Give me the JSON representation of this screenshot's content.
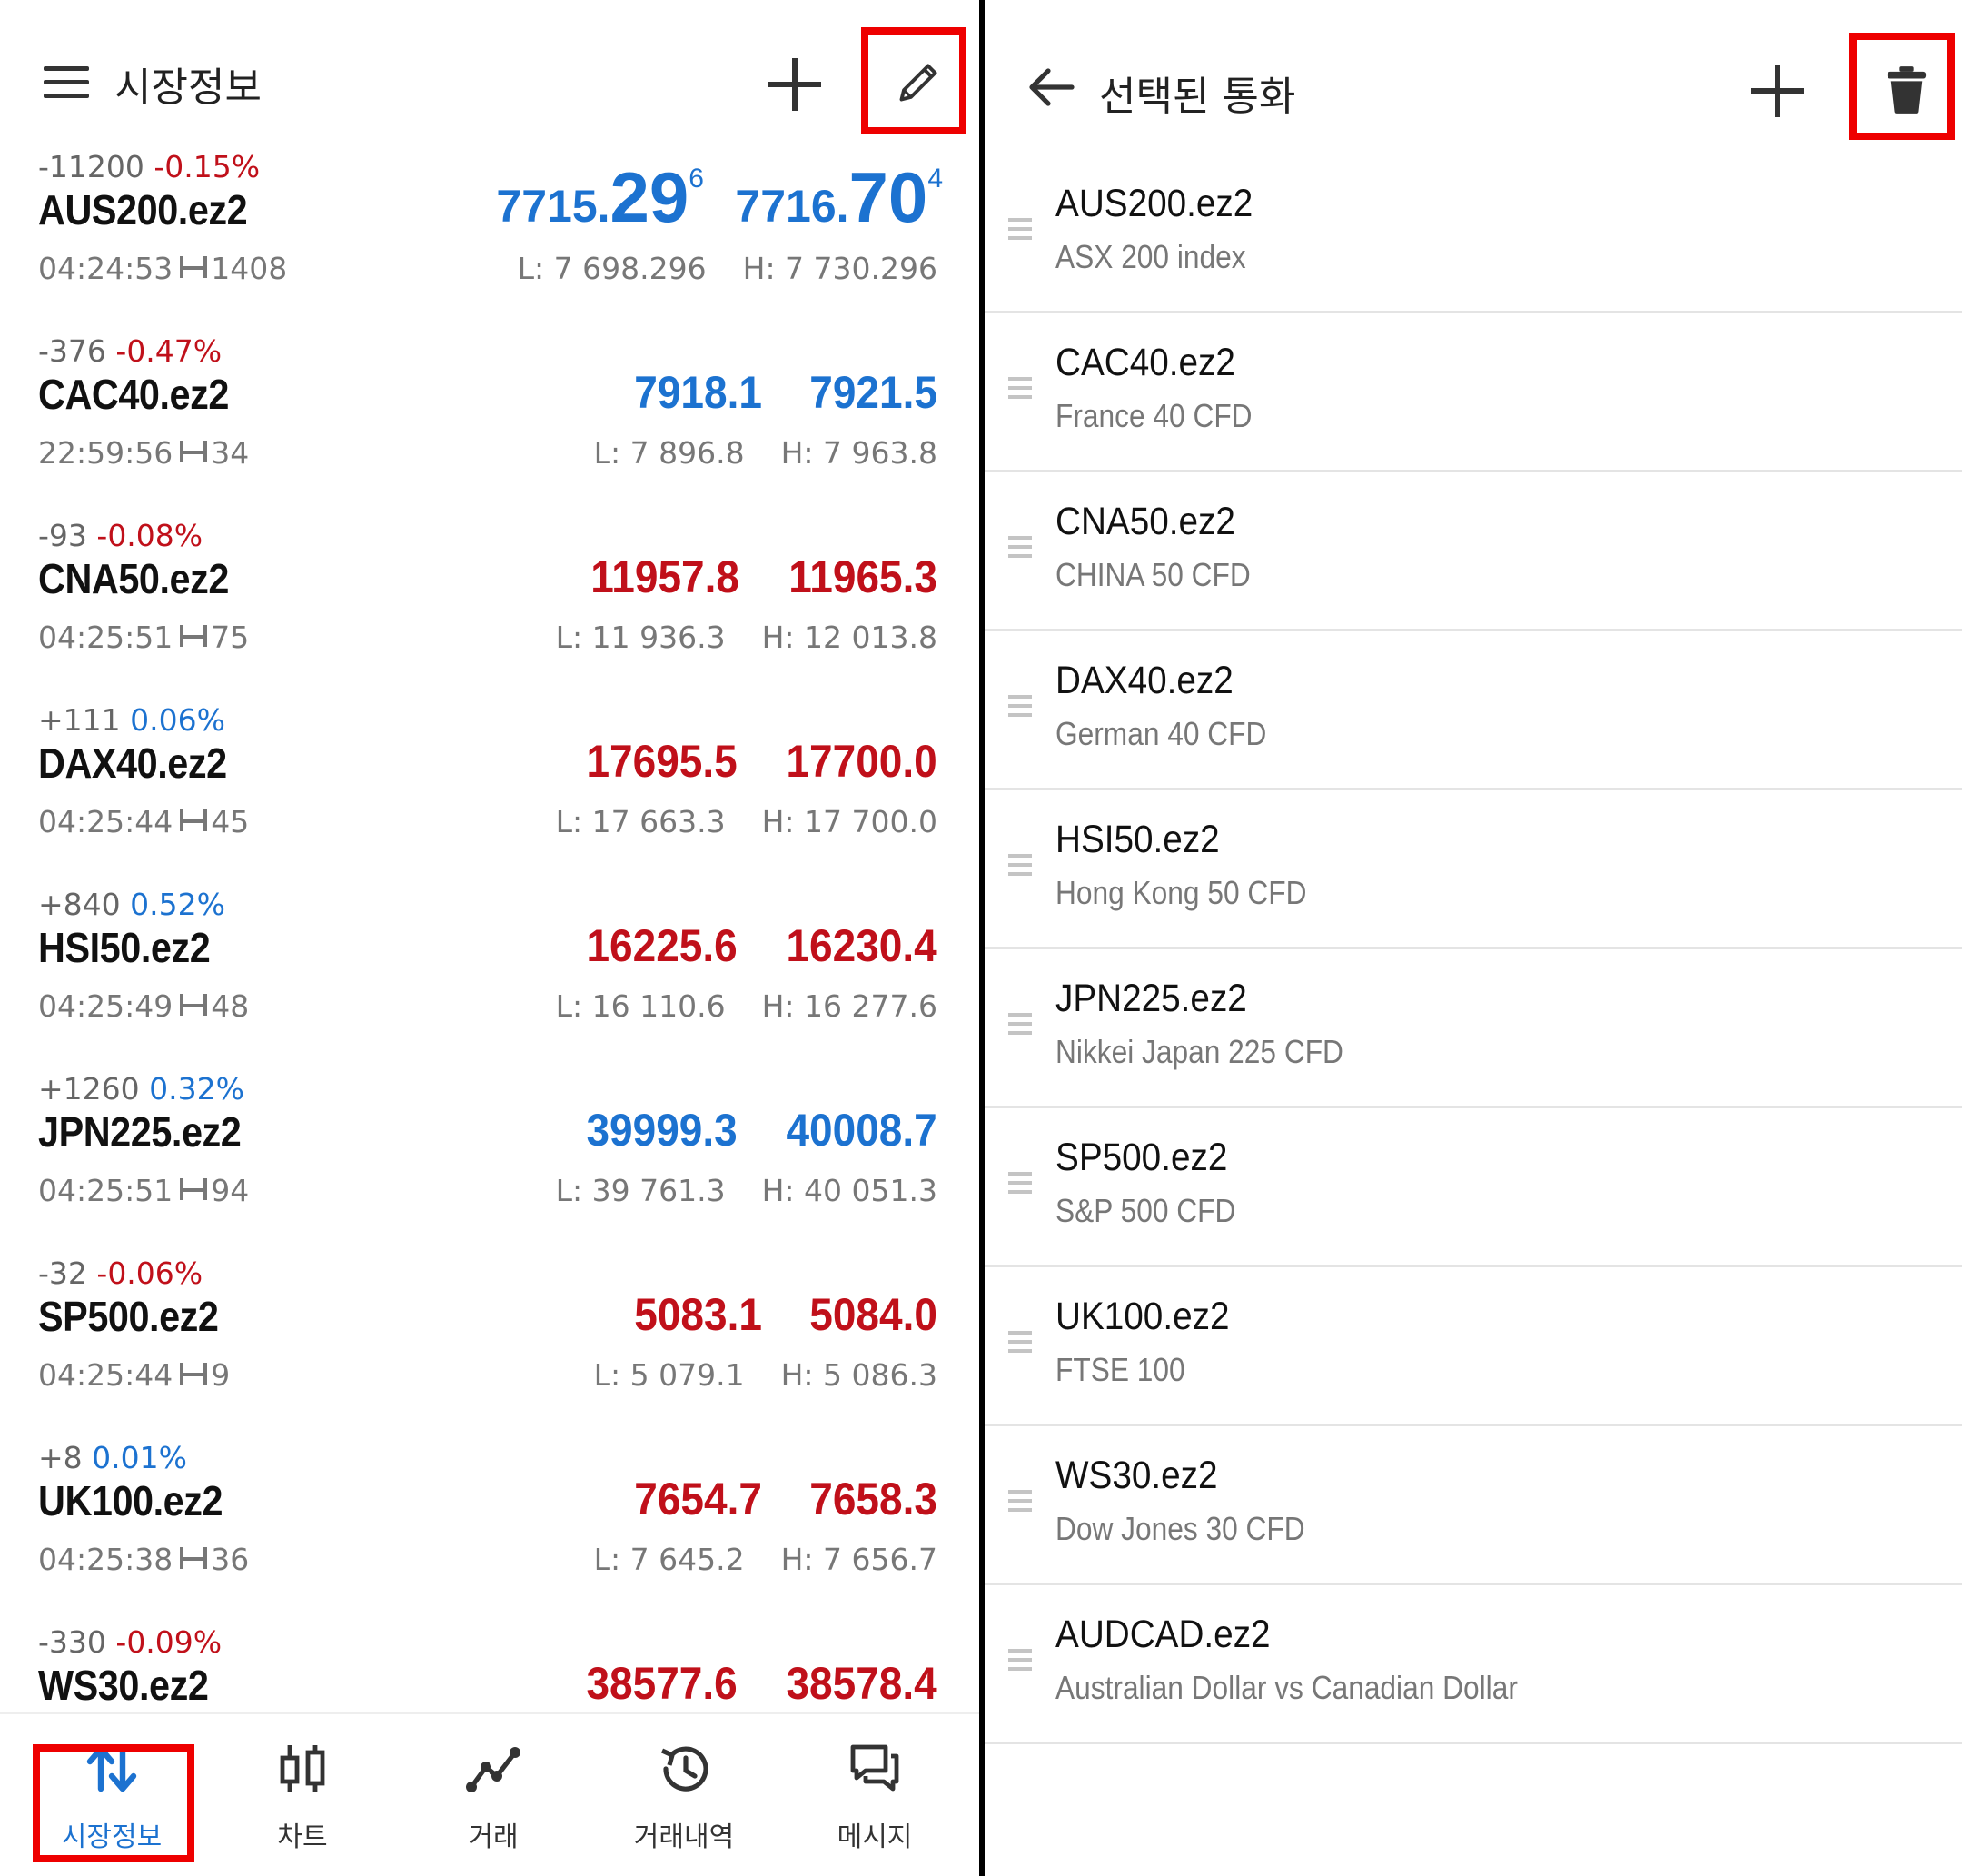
{
  "left": {
    "header": {
      "title": "시장정보"
    },
    "quotes": [
      {
        "symbol": "AUS200.ez2",
        "change": "-11200",
        "pct": "-0.15%",
        "dir": "neg",
        "time": "04:24:53",
        "spread": "1408",
        "bid_a": "7715.",
        "bid_b": "29",
        "bid_c": "6",
        "ask_a": "7716.",
        "ask_b": "70",
        "ask_c": "4",
        "low": "L: 7 698.296",
        "high": "H: 7 730.296",
        "color": "blue"
      },
      {
        "symbol": "CAC40.ez2",
        "change": "-376",
        "pct": "-0.47%",
        "dir": "neg",
        "time": "22:59:56",
        "spread": "34",
        "bid": "7918.1",
        "ask": "7921.5",
        "low": "L: 7 896.8",
        "high": "H: 7 963.8",
        "color": "blue"
      },
      {
        "symbol": "CNA50.ez2",
        "change": "-93",
        "pct": "-0.08%",
        "dir": "neg",
        "time": "04:25:51",
        "spread": "75",
        "bid": "11957.8",
        "ask": "11965.3",
        "low": "L: 11 936.3",
        "high": "H: 12 013.8",
        "color": "red"
      },
      {
        "symbol": "DAX40.ez2",
        "change": "+111",
        "pct": "0.06%",
        "dir": "pos",
        "time": "04:25:44",
        "spread": "45",
        "bid": "17695.5",
        "ask": "17700.0",
        "low": "L: 17 663.3",
        "high": "H: 17 700.0",
        "color": "red"
      },
      {
        "symbol": "HSI50.ez2",
        "change": "+840",
        "pct": "0.52%",
        "dir": "pos",
        "time": "04:25:49",
        "spread": "48",
        "bid": "16225.6",
        "ask": "16230.4",
        "low": "L: 16 110.6",
        "high": "H: 16 277.6",
        "color": "red"
      },
      {
        "symbol": "JPN225.ez2",
        "change": "+1260",
        "pct": "0.32%",
        "dir": "pos",
        "time": "04:25:51",
        "spread": "94",
        "bid": "39999.3",
        "ask": "40008.7",
        "low": "L: 39 761.3",
        "high": "H: 40 051.3",
        "color": "blue"
      },
      {
        "symbol": "SP500.ez2",
        "change": "-32",
        "pct": "-0.06%",
        "dir": "neg",
        "time": "04:25:44",
        "spread": "9",
        "bid": "5083.1",
        "ask": "5084.0",
        "low": "L: 5 079.1",
        "high": "H: 5 086.3",
        "color": "red"
      },
      {
        "symbol": "UK100.ez2",
        "change": "+8",
        "pct": "0.01%",
        "dir": "pos",
        "time": "04:25:38",
        "spread": "36",
        "bid": "7654.7",
        "ask": "7658.3",
        "low": "L: 7 645.2",
        "high": "H: 7 656.7",
        "color": "red"
      },
      {
        "symbol": "WS30.ez2",
        "change": "-330",
        "pct": "-0.09%",
        "dir": "neg",
        "time": "",
        "spread": "",
        "bid": "38577.6",
        "ask": "38578.4",
        "low": "",
        "high": "",
        "color": "red"
      }
    ],
    "nav": [
      {
        "label": "시장정보",
        "icon": "arrows-updown-icon",
        "active": true
      },
      {
        "label": "차트",
        "icon": "candlestick-icon",
        "active": false
      },
      {
        "label": "거래",
        "icon": "trend-line-icon",
        "active": false
      },
      {
        "label": "거래내역",
        "icon": "history-icon",
        "active": false
      },
      {
        "label": "메시지",
        "icon": "chat-icon",
        "active": false
      }
    ]
  },
  "right": {
    "header": {
      "title": "선택된 통화"
    },
    "items": [
      {
        "symbol": "AUS200.ez2",
        "desc": "ASX 200 index"
      },
      {
        "symbol": "CAC40.ez2",
        "desc": "France 40 CFD"
      },
      {
        "symbol": "CNA50.ez2",
        "desc": "CHINA 50 CFD"
      },
      {
        "symbol": "DAX40.ez2",
        "desc": "German 40 CFD"
      },
      {
        "symbol": "HSI50.ez2",
        "desc": "Hong Kong 50 CFD"
      },
      {
        "symbol": "JPN225.ez2",
        "desc": "Nikkei Japan 225 CFD"
      },
      {
        "symbol": "SP500.ez2",
        "desc": "S&P 500 CFD"
      },
      {
        "symbol": "UK100.ez2",
        "desc": "FTSE 100"
      },
      {
        "symbol": "WS30.ez2",
        "desc": "Dow Jones 30 CFD"
      },
      {
        "symbol": "AUDCAD.ez2",
        "desc": "Australian Dollar vs Canadian Dollar"
      }
    ]
  },
  "colors": {
    "blue": "#1c72d0",
    "red": "#c0101a",
    "highlight": "#ee0000"
  }
}
